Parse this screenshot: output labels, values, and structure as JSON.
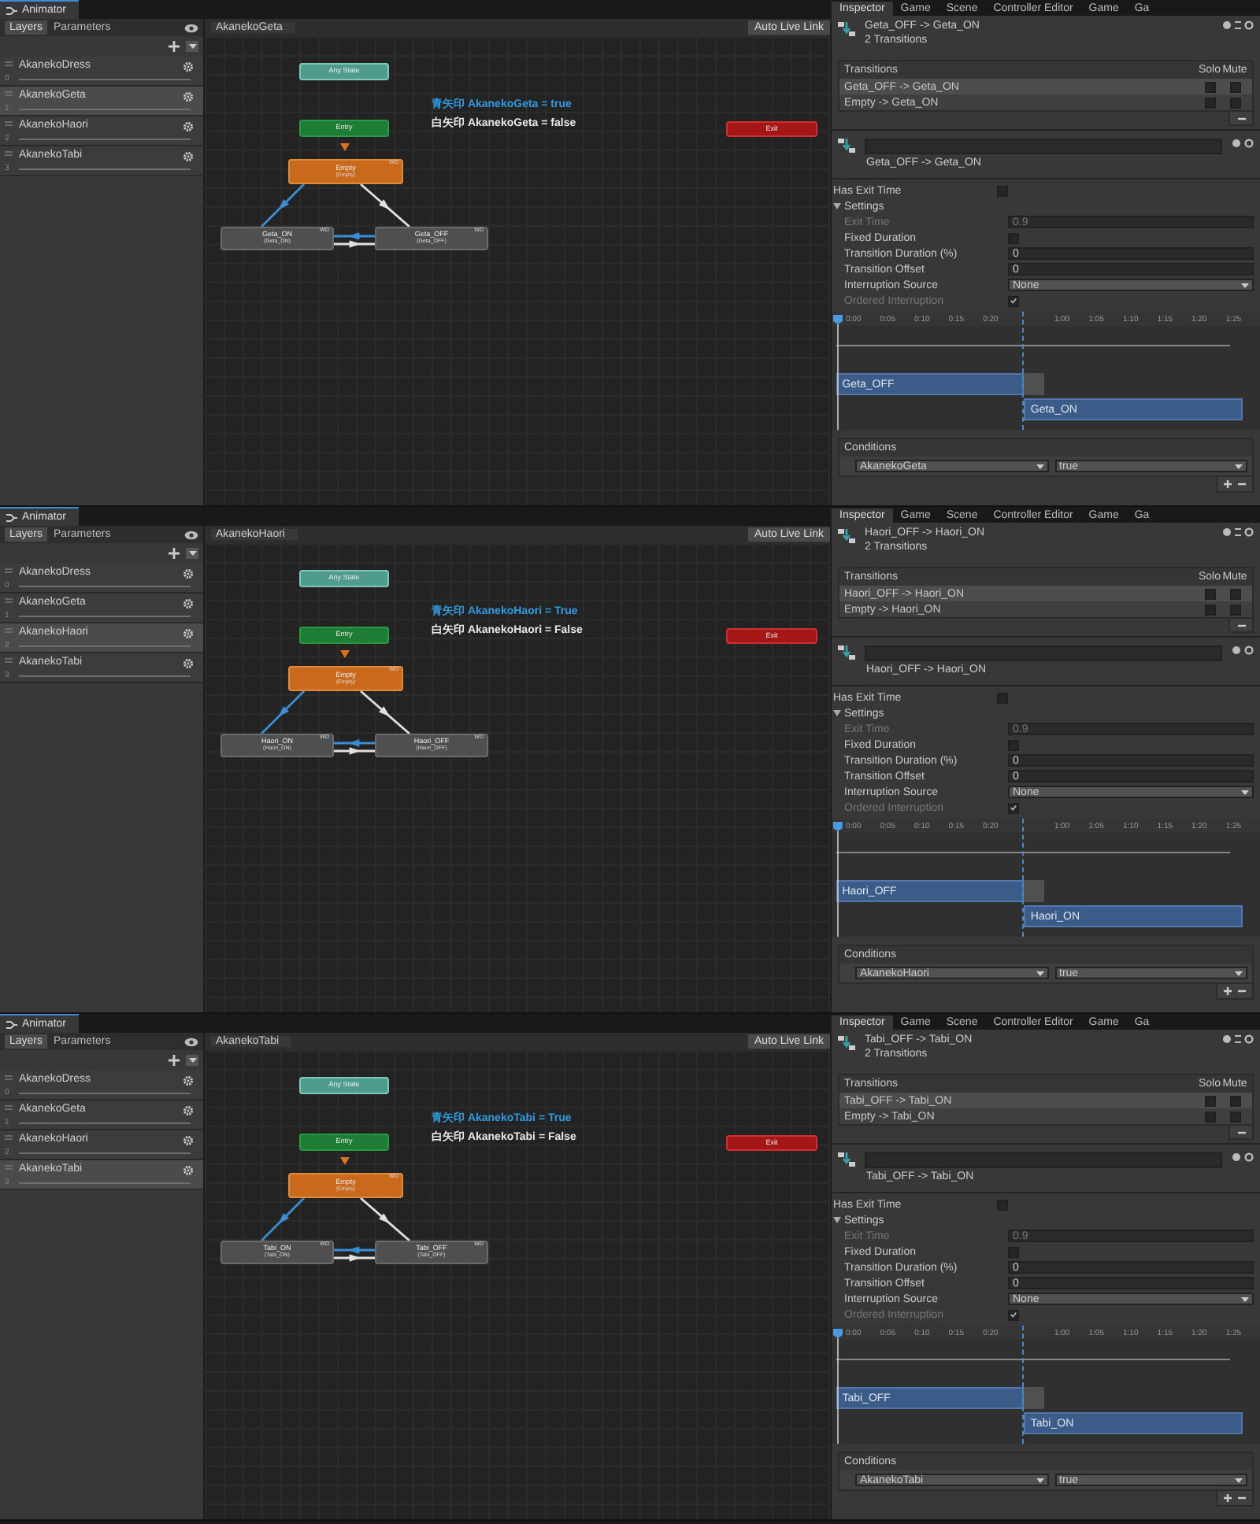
{
  "panels": [
    {
      "animator": {
        "title": "Animator",
        "side_tabs": [
          {
            "label": "Layers",
            "selected": true
          },
          {
            "label": "Parameters",
            "selected": false
          }
        ],
        "layers": [
          {
            "name": "AkanekoDress",
            "index": "0",
            "selected": false
          },
          {
            "name": "AkanekoGeta",
            "index": "1",
            "selected": true
          },
          {
            "name": "AkanekoHaori",
            "index": "2",
            "selected": false
          },
          {
            "name": "AkanekoTabi",
            "index": "3",
            "selected": false
          }
        ],
        "breadcrumb": "AkanekoGeta",
        "live_link": "Auto Live Link",
        "nodes": [
          {
            "kind": "any",
            "label": "Any State"
          },
          {
            "kind": "entry",
            "label": "Entry"
          },
          {
            "kind": "default",
            "label": "Empty",
            "motion": "(Empty)",
            "badge": "WD"
          },
          {
            "kind": "state",
            "label": "Geta_ON",
            "motion": "(Geta_ON)",
            "badge": "WD"
          },
          {
            "kind": "state",
            "label": "Geta_OFF",
            "motion": "(Geta_OFF)",
            "badge": "WD"
          },
          {
            "kind": "exit",
            "label": "Exit"
          }
        ],
        "notes": [
          {
            "text": "青矢印 AkanekoGeta = true",
            "color": "#2f9be0"
          },
          {
            "text": "白矢印 AkanekoGeta = false",
            "color": "#e8e8e8"
          }
        ]
      },
      "inspector": {
        "tabs": [
          {
            "label": "Inspector",
            "selected": true
          },
          {
            "label": "Game",
            "selected": false
          },
          {
            "label": "Scene",
            "selected": false
          },
          {
            "label": "Controller Editor",
            "selected": false
          },
          {
            "label": "Game",
            "selected": false
          },
          {
            "label": "Ga",
            "selected": false
          }
        ],
        "title": "Geta_OFF -> Geta_ON",
        "count": "2 Transitions",
        "transitions": {
          "heading": "Transitions",
          "solo": "Solo",
          "mute": "Mute",
          "rows": [
            {
              "name": "Geta_OFF -> Geta_ON",
              "selected": true,
              "solo": false,
              "mute": false
            },
            {
              "name": "Empty -> Geta_ON",
              "selected": false,
              "solo": false,
              "mute": false
            }
          ]
        },
        "subtitle": "Geta_OFF -> Geta_ON",
        "has_exit_time": {
          "label": "Has Exit Time",
          "checked": false
        },
        "settings": {
          "label": "Settings",
          "expanded": true,
          "rows": [
            {
              "kind": "field",
              "label": "Exit Time",
              "value": "0.9",
              "disabled": true
            },
            {
              "kind": "check",
              "label": "Fixed Duration",
              "checked": false,
              "disabled": false
            },
            {
              "kind": "field",
              "label": "Transition Duration (%)",
              "value": "0",
              "disabled": false
            },
            {
              "kind": "field",
              "label": "Transition Offset",
              "value": "0",
              "disabled": false
            },
            {
              "kind": "dropdown",
              "label": "Interruption Source",
              "value": "None",
              "disabled": false
            },
            {
              "kind": "check",
              "label": "Ordered Interruption",
              "checked": true,
              "disabled": true
            }
          ]
        },
        "timeline": {
          "ticks": [
            "0:00",
            "0:05",
            "0:10",
            "0:15",
            "0:20",
            "1:00",
            "1:05",
            "1:10",
            "1:15",
            "1:20",
            "1:25"
          ],
          "from": "Geta_OFF",
          "to": "Geta_ON"
        },
        "conditions": {
          "heading": "Conditions",
          "rows": [
            {
              "parameter": "AkanekoGeta",
              "value": "true"
            }
          ]
        }
      }
    },
    {
      "animator": {
        "title": "Animator",
        "side_tabs": [
          {
            "label": "Layers",
            "selected": true
          },
          {
            "label": "Parameters",
            "selected": false
          }
        ],
        "layers": [
          {
            "name": "AkanekoDress",
            "index": "0",
            "selected": false
          },
          {
            "name": "AkanekoGeta",
            "index": "1",
            "selected": false
          },
          {
            "name": "AkanekoHaori",
            "index": "2",
            "selected": true
          },
          {
            "name": "AkanekoTabi",
            "index": "3",
            "selected": false
          }
        ],
        "breadcrumb": "AkanekoHaori",
        "live_link": "Auto Live Link",
        "nodes": [
          {
            "kind": "any",
            "label": "Any State"
          },
          {
            "kind": "entry",
            "label": "Entry"
          },
          {
            "kind": "default",
            "label": "Empty",
            "motion": "(Empty)",
            "badge": "WD"
          },
          {
            "kind": "state",
            "label": "Haori_ON",
            "motion": "(Haori_ON)",
            "badge": "WD"
          },
          {
            "kind": "state",
            "label": "Haori_OFF",
            "motion": "(Haori_OFF)",
            "badge": "WD"
          },
          {
            "kind": "exit",
            "label": "Exit"
          }
        ],
        "notes": [
          {
            "text": "青矢印 AkanekoHaori = True",
            "color": "#2f9be0"
          },
          {
            "text": "白矢印 AkanekoHaori = False",
            "color": "#e8e8e8"
          }
        ]
      },
      "inspector": {
        "tabs": [
          {
            "label": "Inspector",
            "selected": true
          },
          {
            "label": "Game",
            "selected": false
          },
          {
            "label": "Scene",
            "selected": false
          },
          {
            "label": "Controller Editor",
            "selected": false
          },
          {
            "label": "Game",
            "selected": false
          },
          {
            "label": "Ga",
            "selected": false
          }
        ],
        "title": "Haori_OFF -> Haori_ON",
        "count": "2 Transitions",
        "transitions": {
          "heading": "Transitions",
          "solo": "Solo",
          "mute": "Mute",
          "rows": [
            {
              "name": "Haori_OFF -> Haori_ON",
              "selected": true,
              "solo": false,
              "mute": false
            },
            {
              "name": "Empty -> Haori_ON",
              "selected": false,
              "solo": false,
              "mute": false
            }
          ]
        },
        "subtitle": "Haori_OFF -> Haori_ON",
        "has_exit_time": {
          "label": "Has Exit Time",
          "checked": false
        },
        "settings": {
          "label": "Settings",
          "expanded": true,
          "rows": [
            {
              "kind": "field",
              "label": "Exit Time",
              "value": "0.9",
              "disabled": true
            },
            {
              "kind": "check",
              "label": "Fixed Duration",
              "checked": false,
              "disabled": false
            },
            {
              "kind": "field",
              "label": "Transition Duration (%)",
              "value": "0",
              "disabled": false
            },
            {
              "kind": "field",
              "label": "Transition Offset",
              "value": "0",
              "disabled": false
            },
            {
              "kind": "dropdown",
              "label": "Interruption Source",
              "value": "None",
              "disabled": false
            },
            {
              "kind": "check",
              "label": "Ordered Interruption",
              "checked": true,
              "disabled": true
            }
          ]
        },
        "timeline": {
          "ticks": [
            "0:00",
            "0:05",
            "0:10",
            "0:15",
            "0:20",
            "1:00",
            "1:05",
            "1:10",
            "1:15",
            "1:20",
            "1:25"
          ],
          "from": "Haori_OFF",
          "to": "Haori_ON"
        },
        "conditions": {
          "heading": "Conditions",
          "rows": [
            {
              "parameter": "AkanekoHaori",
              "value": "true"
            }
          ]
        }
      }
    },
    {
      "animator": {
        "title": "Animator",
        "side_tabs": [
          {
            "label": "Layers",
            "selected": true
          },
          {
            "label": "Parameters",
            "selected": false
          }
        ],
        "layers": [
          {
            "name": "AkanekoDress",
            "index": "0",
            "selected": false
          },
          {
            "name": "AkanekoGeta",
            "index": "1",
            "selected": false
          },
          {
            "name": "AkanekoHaori",
            "index": "2",
            "selected": false
          },
          {
            "name": "AkanekoTabi",
            "index": "3",
            "selected": true
          }
        ],
        "breadcrumb": "AkanekoTabi",
        "live_link": "Auto Live Link",
        "nodes": [
          {
            "kind": "any",
            "label": "Any State"
          },
          {
            "kind": "entry",
            "label": "Entry"
          },
          {
            "kind": "default",
            "label": "Empty",
            "motion": "(Empty)",
            "badge": "WD"
          },
          {
            "kind": "state",
            "label": "Tabi_ON",
            "motion": "(Tabi_ON)",
            "badge": "WD"
          },
          {
            "kind": "state",
            "label": "Tabi_OFF",
            "motion": "(Tabi_OFF)",
            "badge": "WD"
          },
          {
            "kind": "exit",
            "label": "Exit"
          }
        ],
        "notes": [
          {
            "text": "青矢印 AkanekoTabi = True",
            "color": "#2f9be0"
          },
          {
            "text": "白矢印 AkanekoTabi = False",
            "color": "#e8e8e8"
          }
        ]
      },
      "inspector": {
        "tabs": [
          {
            "label": "Inspector",
            "selected": true
          },
          {
            "label": "Game",
            "selected": false
          },
          {
            "label": "Scene",
            "selected": false
          },
          {
            "label": "Controller Editor",
            "selected": false
          },
          {
            "label": "Game",
            "selected": false
          },
          {
            "label": "Ga",
            "selected": false
          }
        ],
        "title": "Tabi_OFF -> Tabi_ON",
        "count": "2 Transitions",
        "transitions": {
          "heading": "Transitions",
          "solo": "Solo",
          "mute": "Mute",
          "rows": [
            {
              "name": "Tabi_OFF -> Tabi_ON",
              "selected": true,
              "solo": false,
              "mute": false
            },
            {
              "name": "Empty -> Tabi_ON",
              "selected": false,
              "solo": false,
              "mute": false
            }
          ]
        },
        "subtitle": "Tabi_OFF -> Tabi_ON",
        "has_exit_time": {
          "label": "Has Exit Time",
          "checked": false
        },
        "settings": {
          "label": "Settings",
          "expanded": true,
          "rows": [
            {
              "kind": "field",
              "label": "Exit Time",
              "value": "0.9",
              "disabled": true
            },
            {
              "kind": "check",
              "label": "Fixed Duration",
              "checked": false,
              "disabled": false
            },
            {
              "kind": "field",
              "label": "Transition Duration (%)",
              "value": "0",
              "disabled": false
            },
            {
              "kind": "field",
              "label": "Transition Offset",
              "value": "0",
              "disabled": false
            },
            {
              "kind": "dropdown",
              "label": "Interruption Source",
              "value": "None",
              "disabled": false
            },
            {
              "kind": "check",
              "label": "Ordered Interruption",
              "checked": true,
              "disabled": true
            }
          ]
        },
        "timeline": {
          "ticks": [
            "0:00",
            "0:05",
            "0:10",
            "0:15",
            "0:20",
            "1:00",
            "1:05",
            "1:10",
            "1:15",
            "1:20",
            "1:25"
          ],
          "from": "Tabi_OFF",
          "to": "Tabi_ON"
        },
        "conditions": {
          "heading": "Conditions",
          "rows": [
            {
              "parameter": "AkanekoTabi",
              "value": "true"
            }
          ]
        }
      }
    }
  ]
}
